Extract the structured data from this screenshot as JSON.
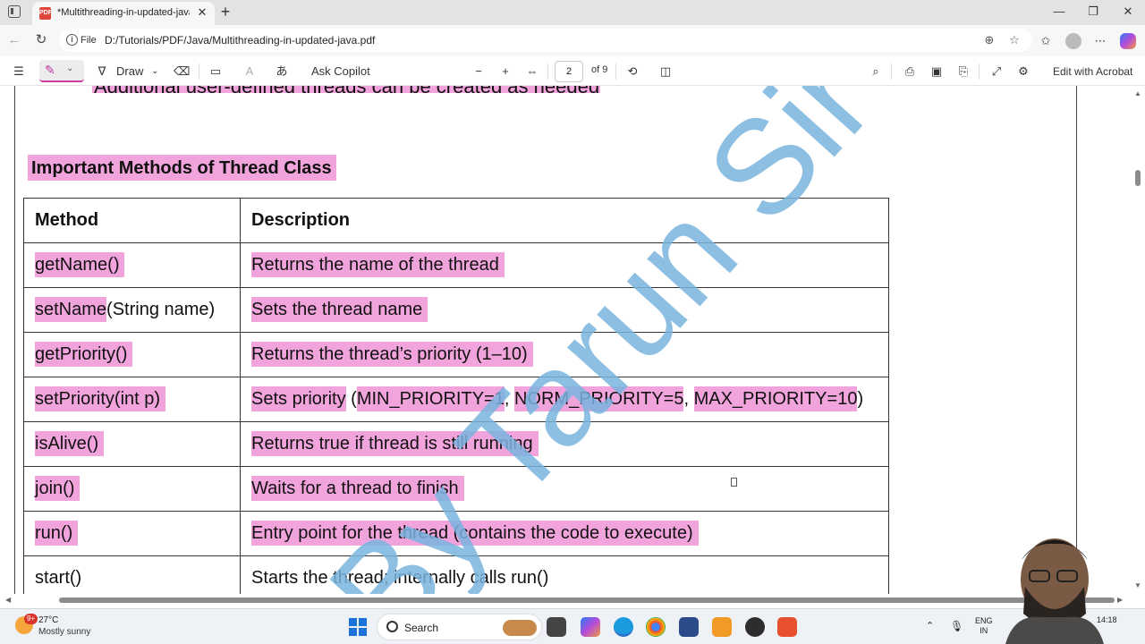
{
  "browser": {
    "tab_title": "*Multithreading-in-updated-java...",
    "favicon_label": "PDF",
    "url_scheme": "File",
    "url": "D:/Tutorials/PDF/Java/Multithreading-in-updated-java.pdf"
  },
  "pdf_toolbar": {
    "draw_label": "Draw",
    "copilot_label": "Ask Copilot",
    "page_number": "2",
    "page_count_label": "of 9",
    "edit_label": "Edit with Acrobat"
  },
  "document": {
    "top_clip_text": "Additional user-defined threads can be created as needed.",
    "heading": "Important Methods of Thread Class",
    "table": {
      "headers": [
        "Method",
        "Description"
      ],
      "rows": [
        {
          "method": "getName()",
          "description": "Returns the name of the thread"
        },
        {
          "method_hl": "setName",
          "method_rest": "(String name)",
          "description": "Sets the thread name"
        },
        {
          "method": "getPriority()",
          "description": "Returns the thread’s priority (1–10)"
        },
        {
          "method": "setPriority(int p)",
          "description_a": "Sets priority",
          "description_b": " (",
          "description_c": "MIN_PRIORITY=1",
          "description_d": ", ",
          "description_e": "NORM_PRIORITY=5",
          "description_f": ", ",
          "description_g": "MAX_PRIORITY=10",
          "description_h": ")"
        },
        {
          "method": "isAlive()",
          "description": "Returns true if thread is still running"
        },
        {
          "method": "join()",
          "description": "Waits for a thread to finish"
        },
        {
          "method": "run()",
          "description": "Entry point for the thread (contains the code to execute)"
        },
        {
          "method": "start()",
          "description": "Starts the thread; internally calls run()"
        }
      ]
    },
    "watermark": "By Tarun Sir"
  },
  "taskbar": {
    "weather_badge": "9+",
    "temperature": "27°C",
    "weather": "Mostly sunny",
    "search_label": "Search",
    "lang_line1": "ENG",
    "lang_line2": "IN",
    "clock": "14:18"
  },
  "colors": {
    "highlight": "#f1a4dc",
    "watermark": "#79b4de",
    "accent": "#d33aa6"
  }
}
